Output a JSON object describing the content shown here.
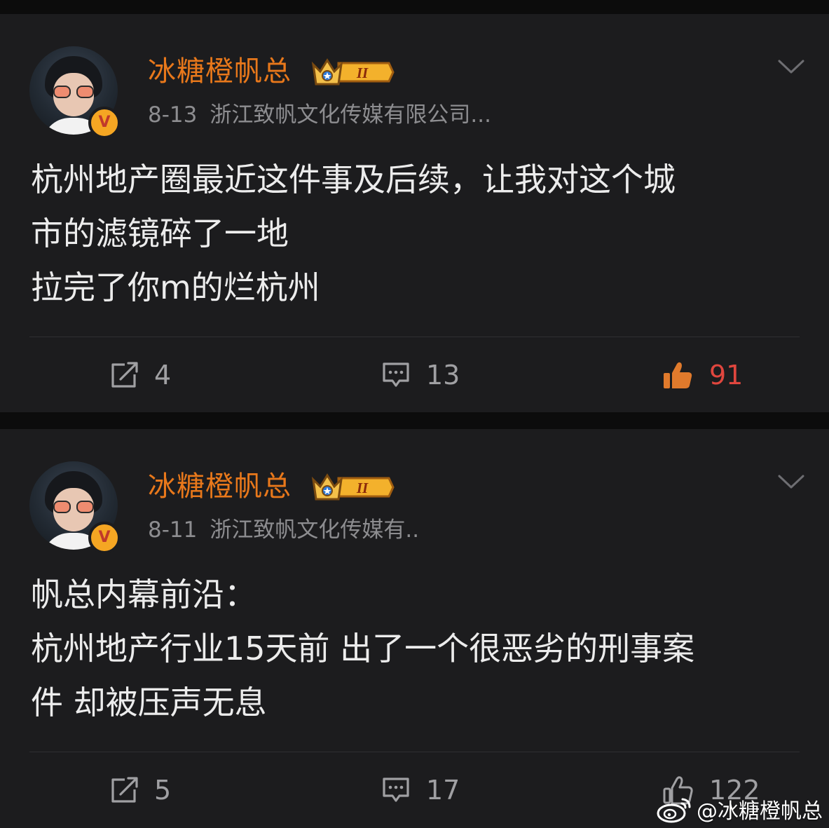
{
  "posts": [
    {
      "username": "冰糖橙帆总",
      "level_badge": "II",
      "date": "8-13",
      "source": "浙江致帆文化传媒有限公司...",
      "content_lines": [
        "杭州地产圈最近这件事及后续，让我对这个城",
        "市的滤镜碎了一地",
        "拉完了你m的烂杭州"
      ],
      "reposts": "4",
      "comments": "13",
      "likes": "91",
      "liked": true
    },
    {
      "username": "冰糖橙帆总",
      "level_badge": "II",
      "date": "8-11",
      "source": "浙江致帆文化传媒有..",
      "content_lines": [
        "帆总内幕前沿：",
        "杭州地产行业15天前 出了一个很恶劣的刑事案",
        "件 却被压声无息"
      ],
      "reposts": "5",
      "comments": "17",
      "likes": "122",
      "liked": false
    }
  ],
  "watermark": "@冰糖橙帆总",
  "colors": {
    "background": "#0c0c0c",
    "card": "#1c1c1e",
    "username": "#e8781b",
    "meta": "#8d8d90",
    "text": "#ececec",
    "action": "#a0a0a3",
    "liked": "#e0463e"
  }
}
